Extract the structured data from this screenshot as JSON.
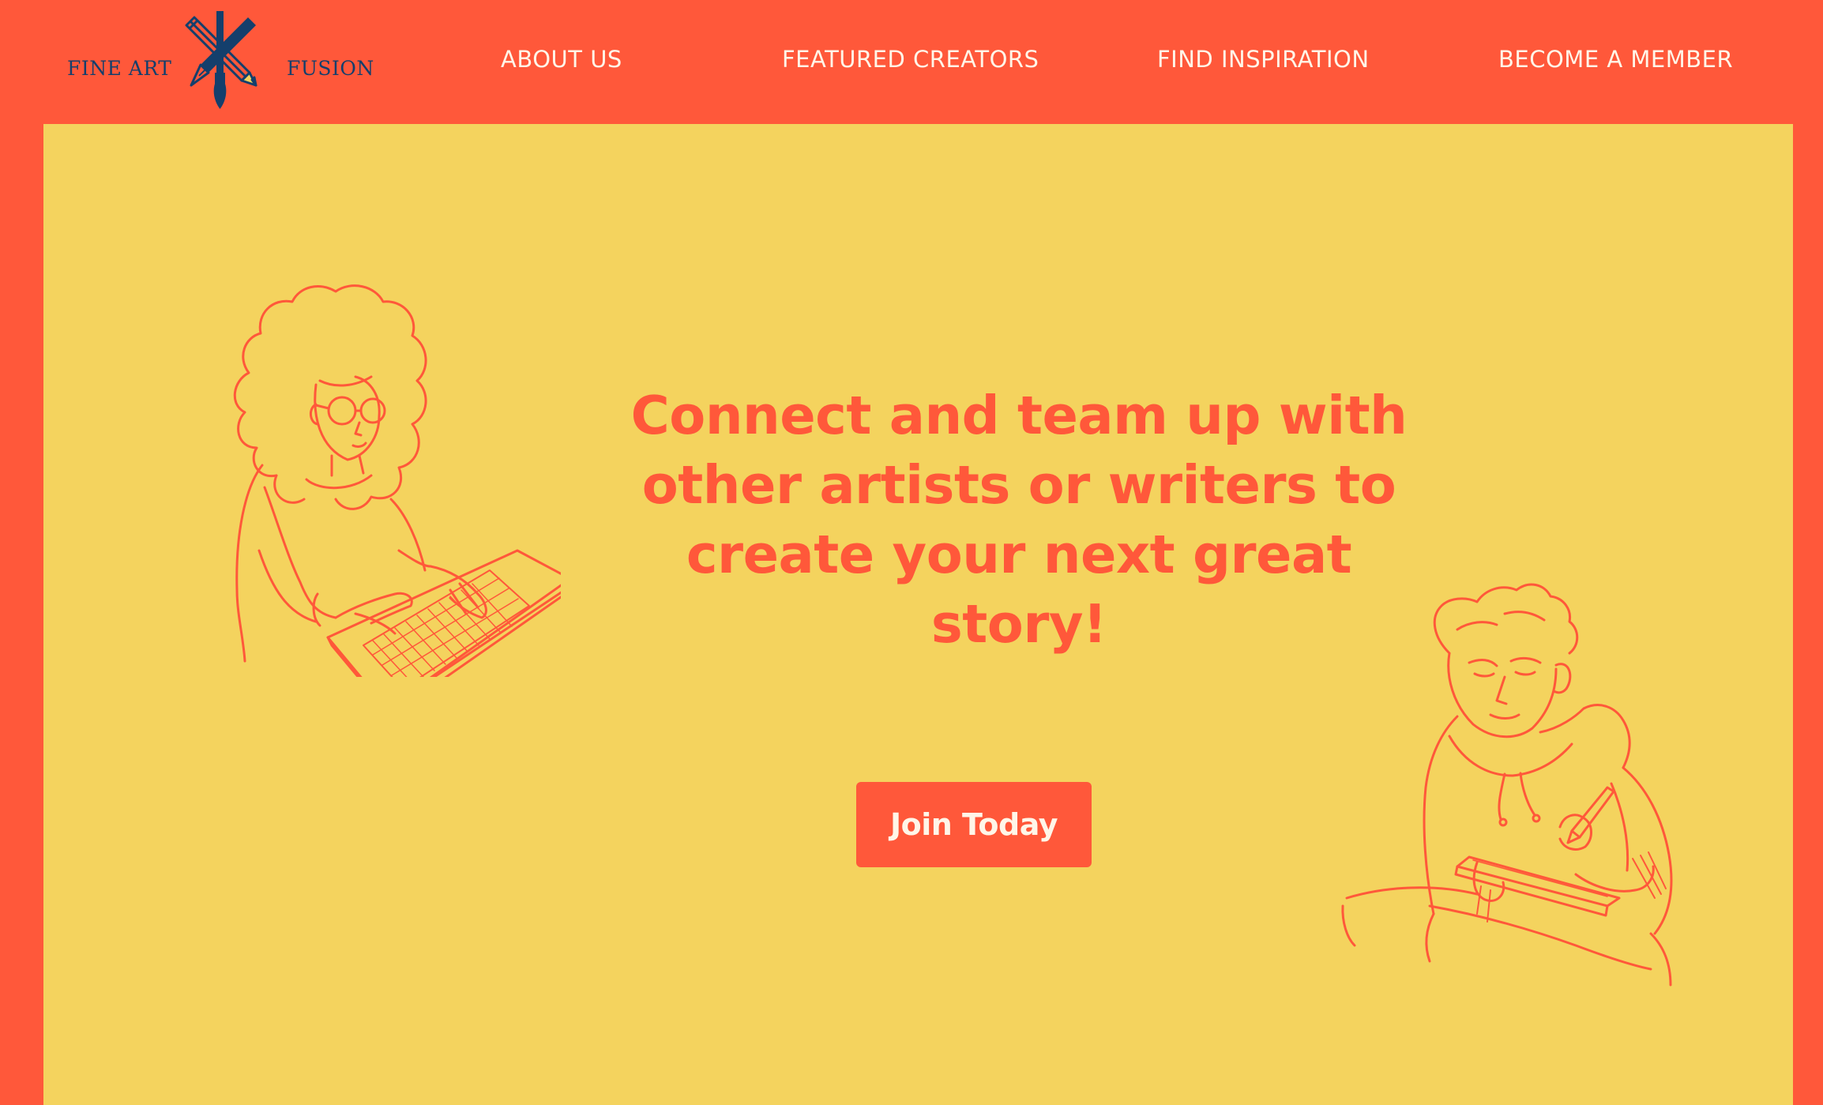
{
  "brand": {
    "left_word": "FINE ART",
    "right_word": "FUSION",
    "logo_icon": "crossed-pencil-pen-brush-logo"
  },
  "nav": {
    "items": [
      {
        "label": "ABOUT US"
      },
      {
        "label": "FEATURED CREATORS"
      },
      {
        "label": "FIND INSPIRATION"
      },
      {
        "label": "BECOME A MEMBER"
      }
    ]
  },
  "hero": {
    "headline": "Connect and team up with other artists or writers to create your next great story!",
    "cta_label": "Join Today",
    "illustrations": [
      {
        "icon": "woman-typing-on-laptop-illustration"
      },
      {
        "icon": "man-writing-in-notebook-illustration"
      }
    ]
  },
  "colors": {
    "primary": "#FF583A",
    "background": "#F4D35E",
    "logo_navy": "#143F6C",
    "nav_text": "#FFF6E8"
  }
}
